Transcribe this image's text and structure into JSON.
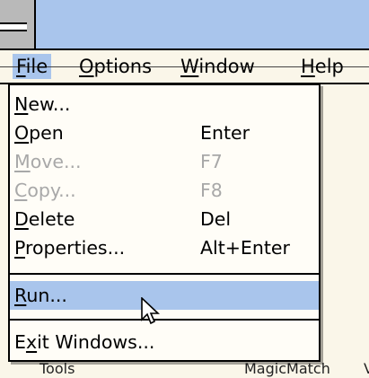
{
  "menubar": {
    "items": [
      {
        "label": "File",
        "mnemonic": "F",
        "rest": "ile"
      },
      {
        "label": "Options",
        "mnemonic": "O",
        "rest": "ptions"
      },
      {
        "label": "Window",
        "mnemonic": "W",
        "rest": "indow"
      },
      {
        "label": "Help",
        "mnemonic": "H",
        "rest": "elp"
      }
    ]
  },
  "file_menu": {
    "items": [
      {
        "m": "N",
        "rest": "ew...",
        "accel": ""
      },
      {
        "m": "O",
        "rest": "pen",
        "accel": "Enter"
      },
      {
        "m": "M",
        "rest": "ove...",
        "accel": "F7"
      },
      {
        "m": "C",
        "rest": "opy...",
        "accel": "F8"
      },
      {
        "m": "D",
        "rest": "elete",
        "accel": "Del"
      },
      {
        "m": "P",
        "rest": "roperties...",
        "accel": "Alt+Enter"
      },
      {
        "m": "R",
        "rest": "un...",
        "accel": ""
      },
      {
        "pre": "E",
        "m": "x",
        "rest": "it Windows...",
        "accel": ""
      }
    ]
  },
  "background": {
    "left_text": "Tools",
    "right_text": "MagicMatch",
    "edge_text": "V"
  }
}
